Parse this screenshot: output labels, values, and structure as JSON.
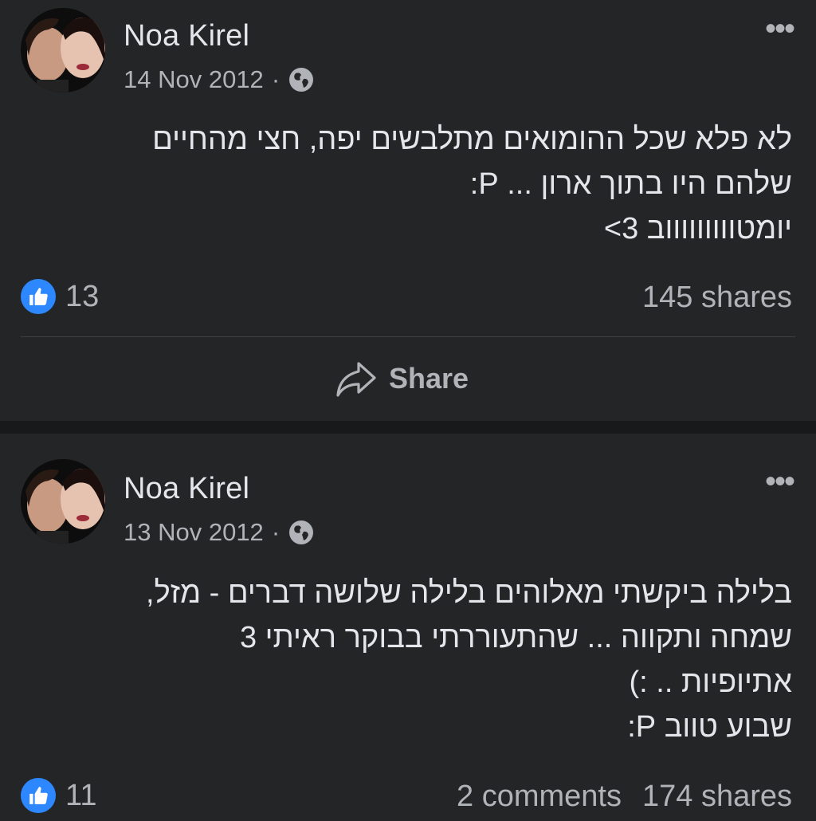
{
  "posts": [
    {
      "author": "Noa Kirel",
      "date": "14 Nov 2012",
      "separator": "·",
      "privacy_icon": "globe-icon",
      "more_label": "•••",
      "lines": [
        "לא פלא שכל ההומואים מתלבשים יפה, חצי מהחיים",
        "שלהם היו בתוך ארון ... P:",
        "יומטוווווווווב 3>"
      ],
      "likes": "13",
      "comments": "",
      "shares": "145 shares",
      "share_label": "Share"
    },
    {
      "author": "Noa Kirel",
      "date": "13 Nov 2012",
      "separator": "·",
      "privacy_icon": "globe-icon",
      "more_label": "•••",
      "lines": [
        "בלילה ביקשתי מאלוהים בלילה שלושה דברים - מזל,",
        "שמחה ותקווה ... שהתעוררתי בבוקר ראיתי 3",
        "אתיופיות .. :)",
        "שבוע טווב P:"
      ],
      "likes": "11",
      "comments": "2 comments",
      "shares": "174 shares"
    }
  ],
  "colors": {
    "background": "#242526",
    "separator_band": "#18191a",
    "text_primary": "#e4e6eb",
    "text_secondary": "#b0b3b8",
    "like_blue": "#2d88ff"
  }
}
